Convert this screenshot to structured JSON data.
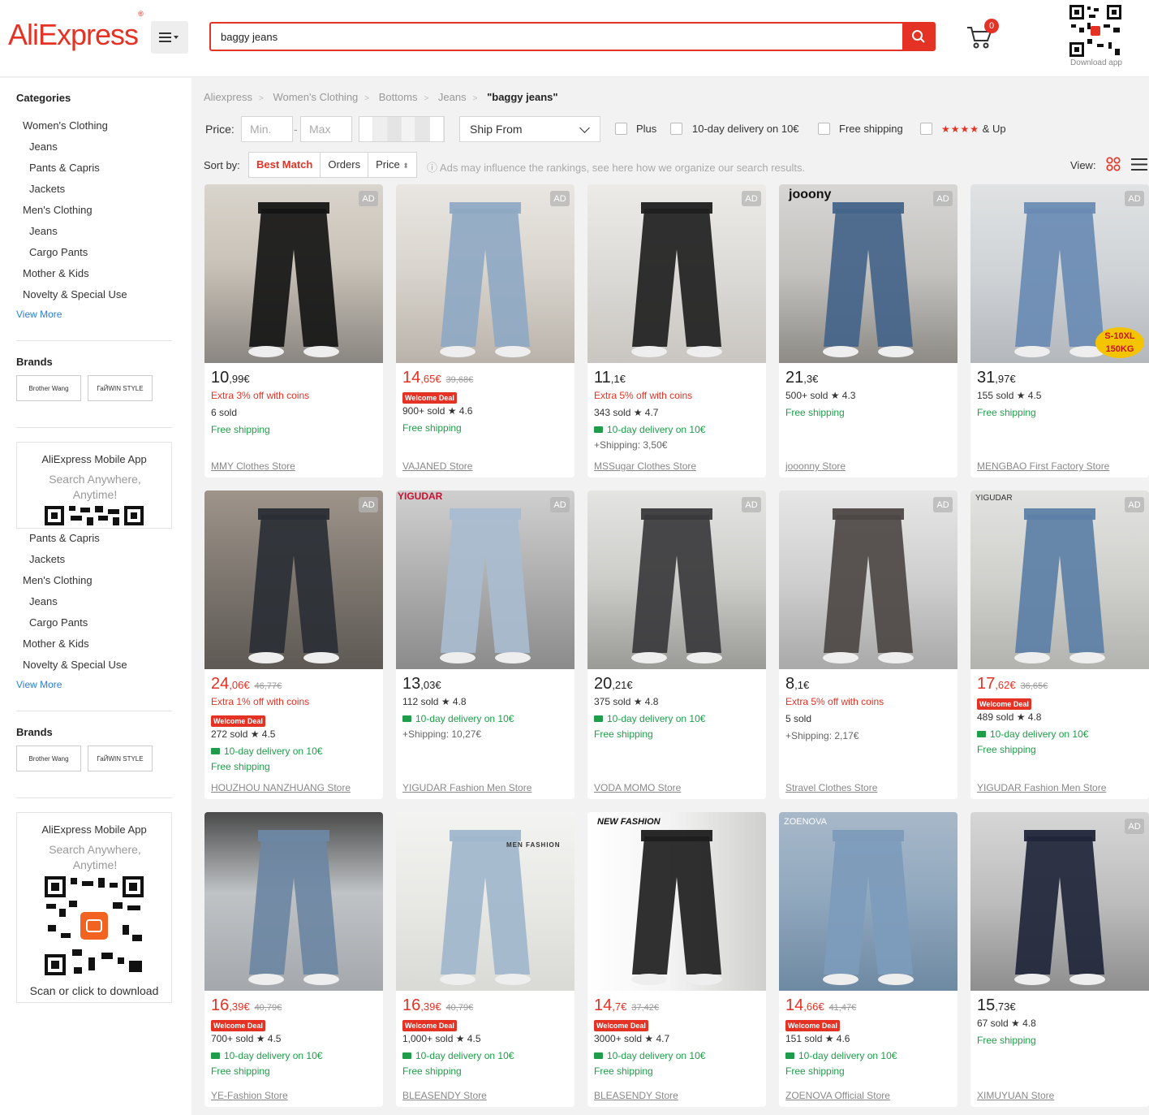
{
  "header": {
    "logo": "AliExpress",
    "search_value": "baggy jeans",
    "cart_count": "0",
    "download_app": "Download app"
  },
  "sidebar": {
    "categories_title": "Categories",
    "categories": [
      "Women's Clothing",
      "Jeans",
      "Pants & Capris",
      "Jackets",
      "Men's Clothing",
      "Jeans",
      "Cargo Pants",
      "Mother & Kids",
      "Novelty & Special Use"
    ],
    "categories_repeat": [
      "Pants & Capris",
      "Jackets",
      "Men's Clothing",
      "Jeans",
      "Cargo Pants",
      "Mother & Kids",
      "Novelty & Special Use"
    ],
    "view_more": "View More",
    "brands_title": "Brands",
    "brands": [
      "Brother Wang",
      "ГаЙWIN STYLE"
    ],
    "app_title": "AliExpress Mobile App",
    "app_sub": "Search Anywhere, Anytime!",
    "app_download": "Scan or click to download"
  },
  "breadcrumb": [
    "Aliexpress",
    "Women's Clothing",
    "Bottoms",
    "Jeans",
    "\"baggy jeans\""
  ],
  "filters": {
    "price_label": "Price:",
    "min_placeholder": "Min.",
    "max_placeholder": "Max",
    "ship_from": "Ship From",
    "plus": "Plus",
    "delivery": "10-day delivery on 10€",
    "free_shipping": "Free shipping",
    "rating_up": "& Up",
    "rating_stars": "★★★★"
  },
  "sort": {
    "label": "Sort by:",
    "options": [
      "Best Match",
      "Orders",
      "Price"
    ],
    "ads_note": "Ads may influence the rankings, see here how we organize our search results.",
    "view_label": "View:"
  },
  "products": [
    {
      "ad": "AD",
      "price_int": "10",
      "price_dec": ",99€",
      "old": "",
      "red": false,
      "lines": [
        [
          "red",
          "Extra 3% off with coins"
        ],
        [
          "dark",
          "6 sold"
        ],
        [
          "green",
          "Free shipping"
        ]
      ],
      "store": "MMY Clothes Store"
    },
    {
      "ad": "AD",
      "price_int": "14",
      "price_dec": ",65€",
      "old": "39,68€",
      "red": true,
      "lines": [
        [
          "deal",
          "Welcome Deal"
        ],
        [
          "dark",
          "900+ sold  ★ 4.6"
        ],
        [
          "green",
          "Free shipping"
        ]
      ],
      "store": "VAJANED Store"
    },
    {
      "ad": "AD",
      "price_int": "11",
      "price_dec": ",1€",
      "old": "",
      "red": false,
      "lines": [
        [
          "red",
          "Extra 5% off with coins"
        ],
        [
          "dark",
          "343 sold  ★ 4.7"
        ],
        [
          "truck",
          "10-day delivery on 10€"
        ],
        [
          "gray",
          "+Shipping: 3,50€"
        ]
      ],
      "store": "MSSugar Clothes Store"
    },
    {
      "ad": "AD",
      "price_int": "21",
      "price_dec": ",3€",
      "old": "",
      "red": false,
      "lines": [
        [
          "dark",
          "500+ sold  ★ 4.3"
        ],
        [
          "green",
          "Free shipping"
        ]
      ],
      "store": "jooonny Store"
    },
    {
      "ad": "AD",
      "price_int": "31",
      "price_dec": ",97€",
      "old": "",
      "red": false,
      "lines": [
        [
          "dark",
          "155 sold  ★ 4.5"
        ],
        [
          "green",
          "Free shipping"
        ]
      ],
      "store": "MENGBAO First Factory Store"
    },
    {
      "ad": "AD",
      "price_int": "24",
      "price_dec": ",06€",
      "old": "46,77€",
      "red": true,
      "lines": [
        [
          "red",
          "Extra 1% off with coins"
        ],
        [
          "deal",
          "Welcome Deal"
        ],
        [
          "dark",
          "272 sold  ★ 4.5"
        ],
        [
          "truck",
          "10-day delivery on 10€"
        ],
        [
          "green",
          "Free shipping"
        ]
      ],
      "store": "HOUZHOU NANZHUANG Store"
    },
    {
      "ad": "AD",
      "price_int": "13",
      "price_dec": ",03€",
      "old": "",
      "red": false,
      "lines": [
        [
          "dark",
          "112 sold  ★ 4.8"
        ],
        [
          "truck",
          "10-day delivery on 10€"
        ],
        [
          "gray",
          "+Shipping: 10,27€"
        ]
      ],
      "store": "YIGUDAR Fashion Men Store"
    },
    {
      "ad": "AD",
      "price_int": "20",
      "price_dec": ",21€",
      "old": "",
      "red": false,
      "lines": [
        [
          "dark",
          "375 sold  ★ 4.8"
        ],
        [
          "truck",
          "10-day delivery on 10€"
        ],
        [
          "green",
          "Free shipping"
        ]
      ],
      "store": "VODA MOMO Store"
    },
    {
      "ad": "AD",
      "price_int": "8",
      "price_dec": ",1€",
      "old": "",
      "red": false,
      "lines": [
        [
          "red",
          "Extra 5% off with coins"
        ],
        [
          "dark",
          "5 sold"
        ],
        [
          "gray",
          "+Shipping: 2,17€"
        ]
      ],
      "store": "Stravel Clothes Store"
    },
    {
      "ad": "AD",
      "price_int": "17",
      "price_dec": ",62€",
      "old": "36,65€",
      "red": true,
      "lines": [
        [
          "deal",
          "Welcome Deal"
        ],
        [
          "dark",
          "489 sold  ★ 4.8"
        ],
        [
          "truck",
          "10-day delivery on 10€"
        ],
        [
          "green",
          "Free shipping"
        ]
      ],
      "store": "YIGUDAR Fashion Men Store"
    },
    {
      "ad": "",
      "price_int": "16",
      "price_dec": ",39€",
      "old": "40,79€",
      "red": true,
      "lines": [
        [
          "deal",
          "Welcome Deal"
        ],
        [
          "dark",
          "700+ sold  ★ 4.5"
        ],
        [
          "truck",
          "10-day delivery on 10€"
        ],
        [
          "green",
          "Free shipping"
        ]
      ],
      "store": "YE-Fashion Store"
    },
    {
      "ad": "",
      "price_int": "16",
      "price_dec": ",39€",
      "old": "40,79€",
      "red": true,
      "lines": [
        [
          "deal",
          "Welcome Deal"
        ],
        [
          "dark",
          "1,000+ sold  ★ 4.5"
        ],
        [
          "truck",
          "10-day delivery on 10€"
        ],
        [
          "green",
          "Free shipping"
        ]
      ],
      "store": "BLEASENDY Store"
    },
    {
      "ad": "",
      "price_int": "14",
      "price_dec": ",7€",
      "old": "37,42€",
      "red": true,
      "lines": [
        [
          "deal",
          "Welcome Deal"
        ],
        [
          "dark",
          "3000+ sold  ★ 4.7"
        ],
        [
          "truck",
          "10-day delivery on 10€"
        ],
        [
          "green",
          "Free shipping"
        ]
      ],
      "store": "BLEASENDY Store"
    },
    {
      "ad": "",
      "price_int": "14",
      "price_dec": ",66€",
      "old": "41,47€",
      "red": true,
      "lines": [
        [
          "deal",
          "Welcome Deal"
        ],
        [
          "dark",
          "151 sold  ★ 4.6"
        ],
        [
          "truck",
          "10-day delivery on 10€"
        ],
        [
          "green",
          "Free shipping"
        ]
      ],
      "store": "ZOENOVA Official Store"
    },
    {
      "ad": "AD",
      "price_int": "15",
      "price_dec": ",73€",
      "old": "",
      "red": false,
      "lines": [
        [
          "dark",
          "67 sold  ★ 4.8"
        ],
        [
          "green",
          "Free shipping"
        ]
      ],
      "store": "XIMUYUAN Store"
    }
  ],
  "image_labels": {
    "p3": "jooony",
    "p4": "S-10XL 150KG",
    "p6": "YIGUDAR",
    "p9": "YIGUDAR",
    "p11": "MEN FASHION",
    "p12": "NEW FASHION",
    "p13": "ZOENOVA"
  },
  "colors": {
    "brand_red": "#e43225",
    "ship_green": "#1f9d4a",
    "link_blue": "#2b7fd4",
    "page_bg": "#f2f2f2"
  }
}
